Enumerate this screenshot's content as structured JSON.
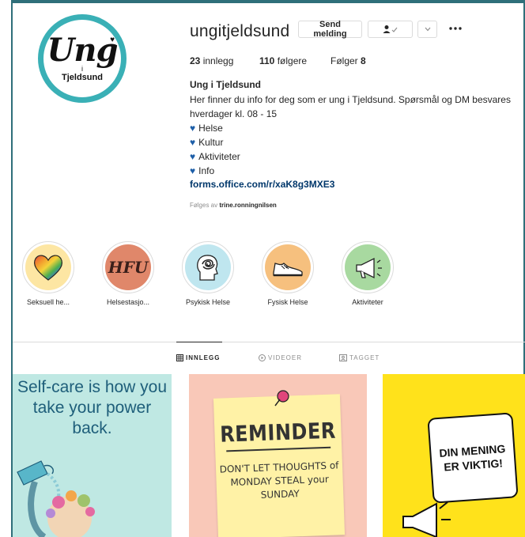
{
  "profile": {
    "username": "ungitjeldsund",
    "avatar_text": {
      "word": "Ung",
      "small": "i",
      "place": "Tjeldsund"
    }
  },
  "actions": {
    "send_message": "Send melding",
    "follow_icon": "person-check-icon",
    "dropdown_icon": "chevron-down-icon",
    "more_icon": "ellipsis-icon"
  },
  "stats": {
    "posts_count": "23",
    "posts_label": "innlegg",
    "followers_count": "110",
    "followers_label": "følgere",
    "following_label": "Følger",
    "following_count": "8"
  },
  "bio": {
    "name": "Ung i Tjeldsund",
    "line1": "Her finner du info for deg som er ung i Tjeldsund. Spørsmål og DM besvares",
    "line2": "hverdager kl. 08 - 15",
    "items": [
      "Helse",
      "Kultur",
      "Aktiviteter",
      "Info"
    ],
    "link": "forms.office.com/r/xaK8g3MXE3",
    "followed_by_prefix": "Følges av",
    "followed_by_user": "trine.ronningnilsen"
  },
  "highlights": [
    {
      "label": "Seksuell he...",
      "icon": "rainbow-heart-icon",
      "bg": "#fde6a3"
    },
    {
      "label": "Helsestasjo...",
      "icon": "hfu-text-icon",
      "bg": "#e0876a"
    },
    {
      "label": "Psykisk Helse",
      "icon": "tangled-head-icon",
      "bg": "#bfe6ef"
    },
    {
      "label": "Fysisk Helse",
      "icon": "sneaker-icon",
      "bg": "#f6c07e"
    },
    {
      "label": "Aktiviteter",
      "icon": "megaphone-icon",
      "bg": "#a8d9a0"
    }
  ],
  "highlight_texts": {
    "hfu": "HFU"
  },
  "tabs": [
    {
      "label": "INNLEGG",
      "icon": "grid-icon",
      "active": true
    },
    {
      "label": "VIDEOER",
      "icon": "play-icon",
      "active": false
    },
    {
      "label": "TAGGET",
      "icon": "tag-icon",
      "active": false
    }
  ],
  "posts": {
    "p1_text": "Self-care is how you take your power back.",
    "p2_title": "REMINDER",
    "p2_body": "DON'T LET THOUGHTS of MONDAY STEAL your SUNDAY",
    "p3_text": "DIN MENING ER VIKTIG!"
  },
  "colors": {
    "heart": "#1e5fa8",
    "link": "#00376b",
    "frame": "#2f6f7a",
    "avatar_ring": "#3ab0b6"
  }
}
